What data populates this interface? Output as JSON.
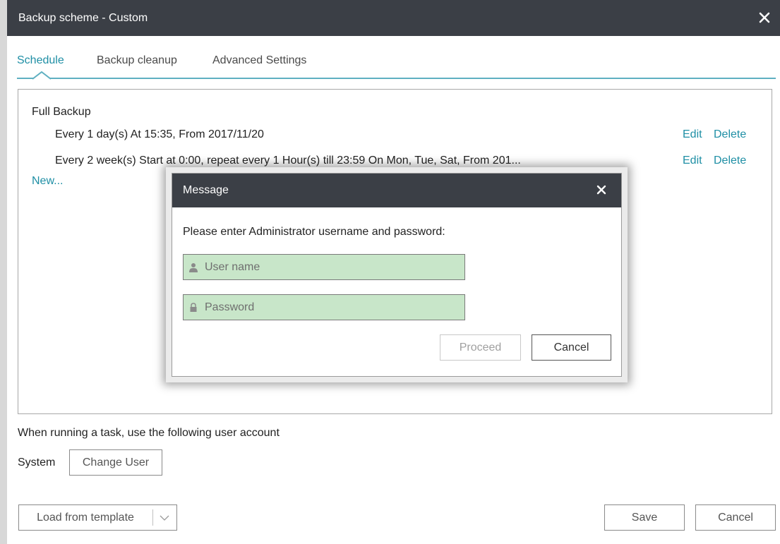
{
  "window": {
    "title": "Backup scheme - Custom",
    "close_icon": "close-icon"
  },
  "tabs": [
    {
      "label": "Schedule",
      "active": true
    },
    {
      "label": "Backup cleanup",
      "active": false
    },
    {
      "label": "Advanced Settings",
      "active": false
    }
  ],
  "schedule": {
    "section_label": "Full Backup",
    "items": [
      {
        "text": "Every 1 day(s) At 15:35, From 2017/11/20",
        "edit": "Edit",
        "delete": "Delete"
      },
      {
        "text": "Every 2 week(s) Start at 0:00, repeat every 1 Hour(s) till 23:59 On Mon, Tue, Sat, From 201...",
        "edit": "Edit",
        "delete": "Delete"
      }
    ],
    "new_link": "New..."
  },
  "account": {
    "label": "When running a task, use the following user account",
    "current_user": "System",
    "change_user_button": "Change User"
  },
  "footer": {
    "load_template_button": "Load from template",
    "save_button": "Save",
    "cancel_button": "Cancel"
  },
  "modal": {
    "title": "Message",
    "prompt": "Please enter Administrator username and password:",
    "username_placeholder": "User name",
    "username_value": "",
    "password_placeholder": "Password",
    "password_value": "",
    "proceed_button": "Proceed",
    "proceed_enabled": false,
    "cancel_button": "Cancel"
  },
  "colors": {
    "titlebar": "#3b3f46",
    "accent": "#1f8fa5",
    "field_fill": "#c8e6c9"
  }
}
